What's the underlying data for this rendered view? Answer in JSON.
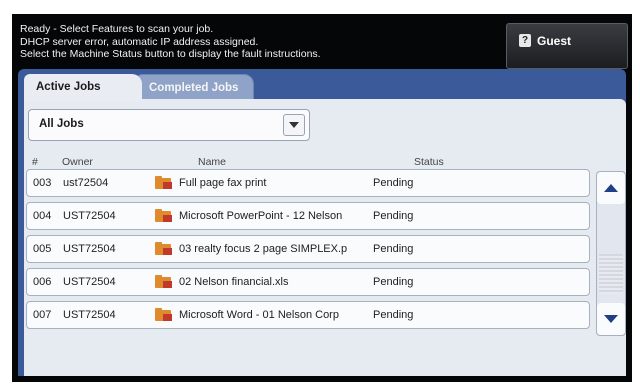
{
  "status_messages": {
    "line1": "Ready -  Select Features to scan your job.",
    "line2": "DHCP server error, automatic IP address assigned.",
    "line3": "Select the Machine Status button to display the fault instructions."
  },
  "guest_button": {
    "label": "Guest",
    "icon": "guest-user-icon"
  },
  "tabs": {
    "active": "Active Jobs",
    "completed": "Completed Jobs"
  },
  "filter": {
    "selected": "All Jobs"
  },
  "columns": {
    "num": "#",
    "owner": "Owner",
    "name": "Name",
    "status": "Status"
  },
  "jobs": [
    {
      "num": "003",
      "owner": "ust72504",
      "name": "Full page fax print",
      "status": "Pending"
    },
    {
      "num": "004",
      "owner": "UST72504",
      "name": "Microsoft PowerPoint - 12 Nelson",
      "status": "Pending"
    },
    {
      "num": "005",
      "owner": "UST72504",
      "name": "03 realty focus 2 page SIMPLEX.p",
      "status": "Pending"
    },
    {
      "num": "006",
      "owner": "UST72504",
      "name": "02 Nelson financial.xls",
      "status": "Pending"
    },
    {
      "num": "007",
      "owner": "UST72504",
      "name": "Microsoft Word - 01 Nelson Corp",
      "status": "Pending"
    }
  ],
  "colors": {
    "screen_bg": "#050608",
    "panel_blue": "#3b5a9a",
    "content_bg": "#e6eaf1",
    "icon_folder": "#e08a2e",
    "icon_printer": "#c0392b"
  }
}
